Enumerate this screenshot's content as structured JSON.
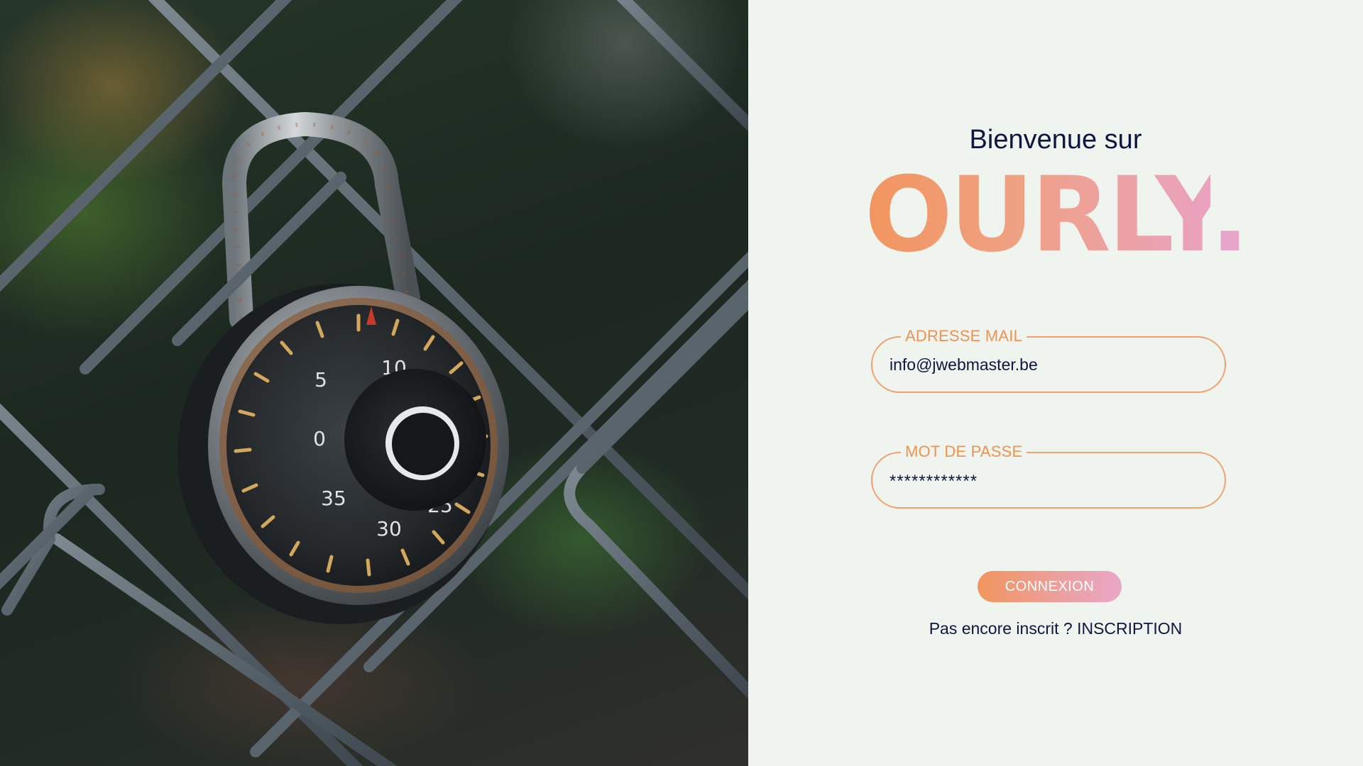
{
  "login": {
    "welcome_text": "Bienvenue sur",
    "brand_name": "OURLY",
    "brand_dot": ".",
    "email_label": "ADRESSE MAIL",
    "email_value": "info@jwebmaster.be",
    "password_label": "MOT DE PASSE",
    "password_value": "************",
    "submit_label": "CONNEXION",
    "signup_prompt": "Pas encore inscrit ?",
    "signup_link": "INSCRIPTION"
  },
  "hero": {
    "lock_dial_numbers": [
      "0",
      "5",
      "10",
      "30",
      "35",
      "25"
    ]
  },
  "colors": {
    "background": "#f0f4ef",
    "text_dark": "#0f1640",
    "accent_orange": "#f2955f",
    "accent_pink": "#e9a7c8"
  }
}
